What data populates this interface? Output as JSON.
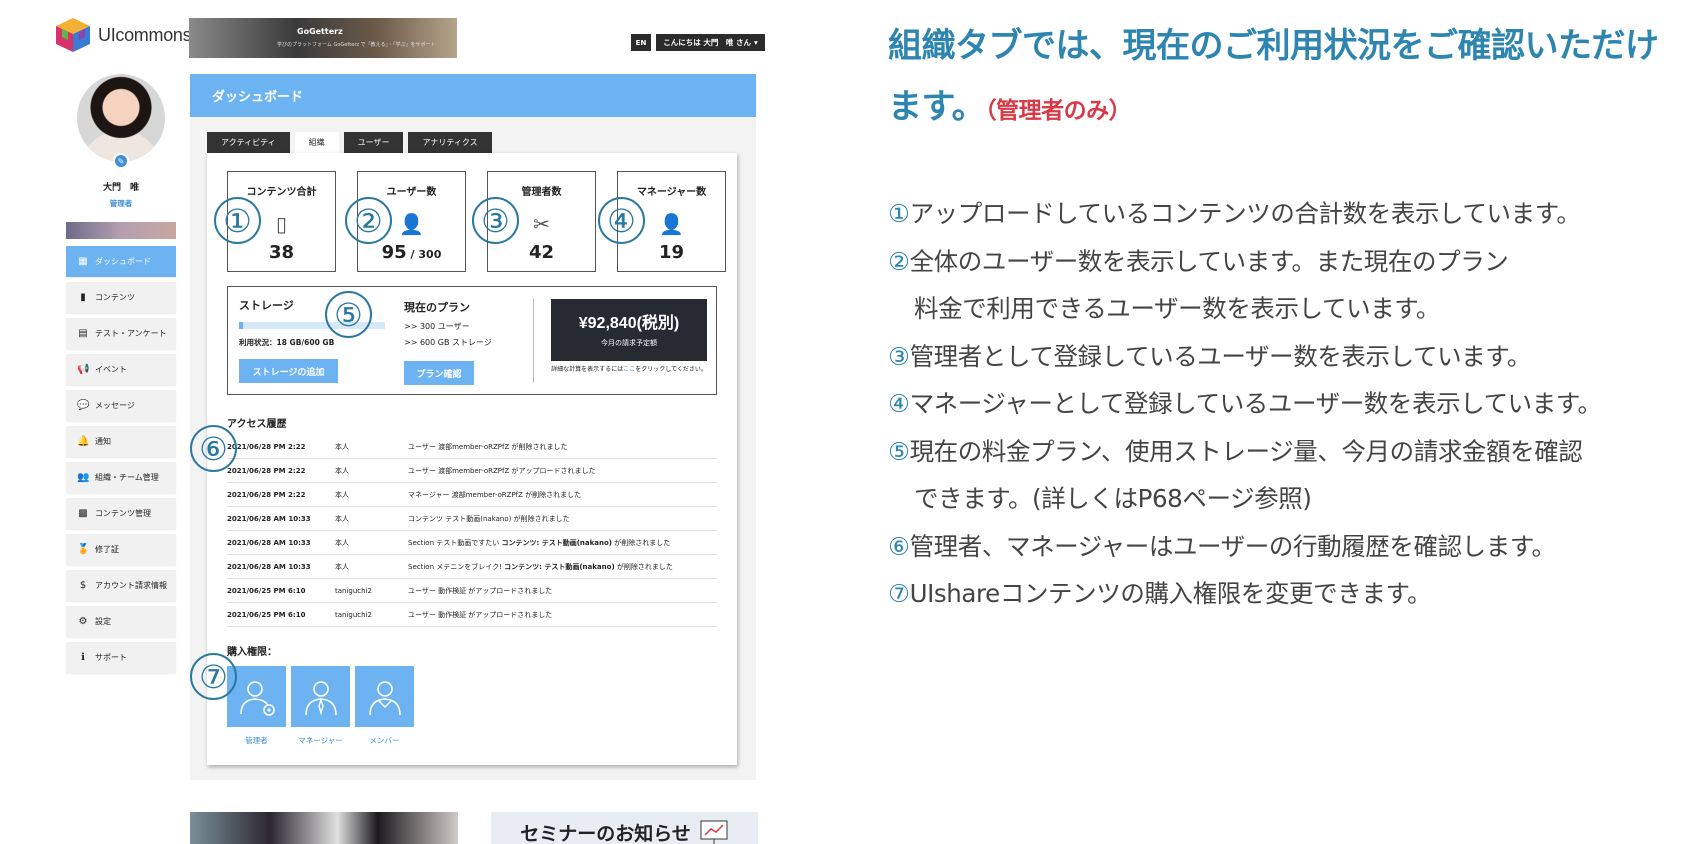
{
  "header": {
    "logo_text": "UIcommons",
    "banner_title": "GoGetterz",
    "banner_sub": "学びのプラットフォーム GoGetterz で「教える」・「学ぶ」をサポート",
    "lang": "EN",
    "greeting": "こんにちは 大門　唯 さん",
    "caret": "▾"
  },
  "profile": {
    "name": "大門　唯",
    "role": "管理者",
    "edit_glyph": "✎"
  },
  "sidebar": {
    "items": [
      {
        "label": "ダッシュボード",
        "icon": "▦"
      },
      {
        "label": "コンテンツ",
        "icon": "▮"
      },
      {
        "label": "テスト・アンケート",
        "icon": "▤"
      },
      {
        "label": "イベント",
        "icon": "📢"
      },
      {
        "label": "メッセージ",
        "icon": "💬"
      },
      {
        "label": "通知",
        "icon": "🔔"
      },
      {
        "label": "組織・チーム管理",
        "icon": "👥"
      },
      {
        "label": "コンテンツ管理",
        "icon": "▩"
      },
      {
        "label": "修了証",
        "icon": "🏅"
      },
      {
        "label": "アカウント請求情報",
        "icon": "$"
      },
      {
        "label": "設定",
        "icon": "⚙"
      },
      {
        "label": "サポート",
        "icon": "ℹ"
      }
    ]
  },
  "dashboard": {
    "title": "ダッシュボード",
    "tabs": [
      "アクティビティ",
      "組織",
      "ユーザー",
      "アナリティクス"
    ],
    "stats": [
      {
        "title": "コンテンツ合計",
        "value": "38",
        "icon": "▯"
      },
      {
        "title": "ユーザー数",
        "value": "95",
        "max": " / 300",
        "icon": "👤"
      },
      {
        "title": "管理者数",
        "value": "42",
        "icon": "✂"
      },
      {
        "title": "マネージャー数",
        "value": "19",
        "icon": "👤"
      }
    ],
    "storage": {
      "title": "ストレージ",
      "usage": "利用状況：18 GB/600 GB",
      "used_fraction": 0.03,
      "button": "ストレージの追加"
    },
    "plan": {
      "title": "現在のプラン",
      "line1": ">> 300 ユーザー",
      "line2": ">> 600 GB ストレージ",
      "button": "プラン確認"
    },
    "bill": {
      "amount": "¥92,840(税別)",
      "label": "今月の請求予定額",
      "note_before": "詳細な計算を表示するには",
      "note_link": "ここ",
      "note_after": "をクリックしてください。"
    },
    "access": {
      "title": "アクセス履歴",
      "rows": [
        {
          "date": "2021/06/28 PM 2:22",
          "user": "本人",
          "msg": "ユーザー 渡部member-oRZPfZ が削除されました",
          "bold": "",
          "msg_after": ""
        },
        {
          "date": "2021/06/28 PM 2:22",
          "user": "本人",
          "msg": "ユーザー 渡部member-oRZPfZ がアップロードされました",
          "bold": "",
          "msg_after": ""
        },
        {
          "date": "2021/06/28 PM 2:22",
          "user": "本人",
          "msg": "マネージャー 渡部member-oRZPfZ が削除されました",
          "bold": "",
          "msg_after": ""
        },
        {
          "date": "2021/06/28 AM 10:33",
          "user": "本人",
          "msg": "コンテンツ テスト動画(nakano) が削除されました",
          "bold": "",
          "msg_after": ""
        },
        {
          "date": "2021/06/28 AM 10:33",
          "user": "本人",
          "msg": "Section テスト動画ですたい ",
          "bold": "コンテンツ: テスト動画(nakano)",
          "msg_after": " が削除されました"
        },
        {
          "date": "2021/06/28 AM 10:33",
          "user": "本人",
          "msg": "Section メテニンをブレイク! ",
          "bold": "コンテンツ: テスト動画(nakano)",
          "msg_after": " が削除されました"
        },
        {
          "date": "2021/06/25 PM 6:10",
          "user": "taniguchi2",
          "msg": "ユーザー 動作検証 がアップロードされました",
          "bold": "",
          "msg_after": ""
        },
        {
          "date": "2021/06/25 PM 6:10",
          "user": "taniguchi2",
          "msg": "ユーザー 動作検証 がアップロードされました",
          "bold": "",
          "msg_after": ""
        }
      ]
    },
    "purchase": {
      "title": "購入権限：",
      "roles": [
        "管理者",
        "マネージャー",
        "メンバー"
      ]
    },
    "markers": [
      "①",
      "②",
      "③",
      "④",
      "⑤",
      "⑥",
      "⑦"
    ]
  },
  "bottom": {
    "seminar": "セミナーのお知らせ"
  },
  "explanation": {
    "headline": "組織タブでは、現在のご利用状況をご確認いただけます。",
    "admin_only": "（管理者のみ）",
    "items": [
      {
        "num": "①",
        "text": "アップロードしているコンテンツの合計数を表示しています。",
        "cont": ""
      },
      {
        "num": "②",
        "text": "全体のユーザー数を表示しています。また現在のプラン",
        "cont": "料金で利用できるユーザー数を表示しています。"
      },
      {
        "num": "③",
        "text": "管理者として登録しているユーザー数を表示しています。",
        "cont": ""
      },
      {
        "num": "④",
        "text": "マネージャーとして登録しているユーザー数を表示しています。",
        "cont": ""
      },
      {
        "num": "⑤",
        "text": "現在の料金プラン、使用ストレージ量、今月の請求金額を確認",
        "cont": "できます。(詳しくはP68ページ参照)"
      },
      {
        "num": "⑥",
        "text": "管理者、マネージャーはユーザーの行動履歴を確認します。",
        "cont": ""
      },
      {
        "num": "⑦",
        "text": "UIshareコンテンツの購入権限を変更できます。",
        "cont": ""
      }
    ]
  }
}
